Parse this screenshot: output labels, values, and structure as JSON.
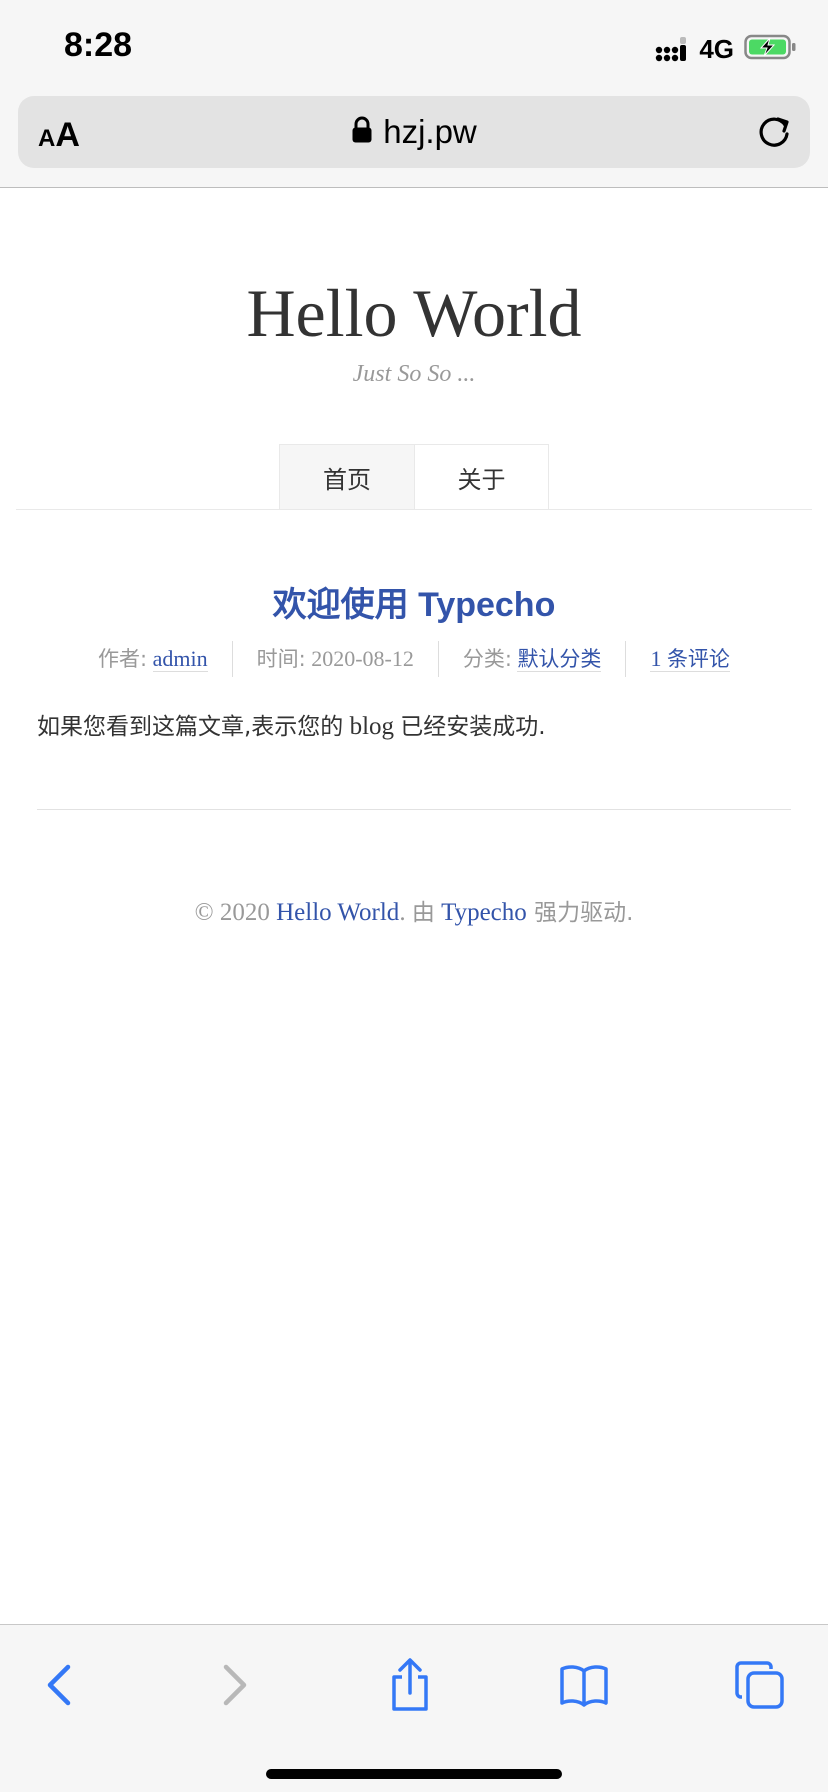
{
  "status_bar": {
    "time": "8:28",
    "network": "4G",
    "signal_icon": "signal-bars-icon",
    "battery_icon": "battery-charging-icon"
  },
  "browser": {
    "reader_small": "A",
    "reader_big": "A",
    "url": "hzj.pw",
    "lock_icon": "lock-icon",
    "reload_icon": "reload-icon"
  },
  "site": {
    "title": "Hello World",
    "description": "Just So So ..."
  },
  "nav": {
    "items": [
      {
        "label": "首页",
        "current": true
      },
      {
        "label": "关于",
        "current": false
      }
    ]
  },
  "post": {
    "title": "欢迎使用 Typecho",
    "meta": {
      "author_label": "作者:",
      "author": "admin",
      "time_label": "时间:",
      "time": "2020-08-12",
      "category_label": "分类:",
      "category": "默认分类",
      "comments_num": "1",
      "comments_text": "条评论"
    },
    "content_part1": "如果您看到这篇文章,表示您的",
    "content_part2": " blog ",
    "content_part3": "已经安装成功."
  },
  "footer": {
    "copyright": "© 2020 ",
    "site_link": "Hello World",
    "dot1": ". ",
    "by": "由",
    "space": " ",
    "engine_link": "Typecho",
    "powered": " 强力驱动."
  },
  "toolbar": {
    "icons": [
      "back-icon",
      "forward-icon",
      "share-icon",
      "bookmarks-icon",
      "tabs-icon"
    ]
  },
  "colors": {
    "accent": "#3354aa",
    "toolbar_blue": "#3478f6",
    "battery_green": "#4cd964"
  }
}
